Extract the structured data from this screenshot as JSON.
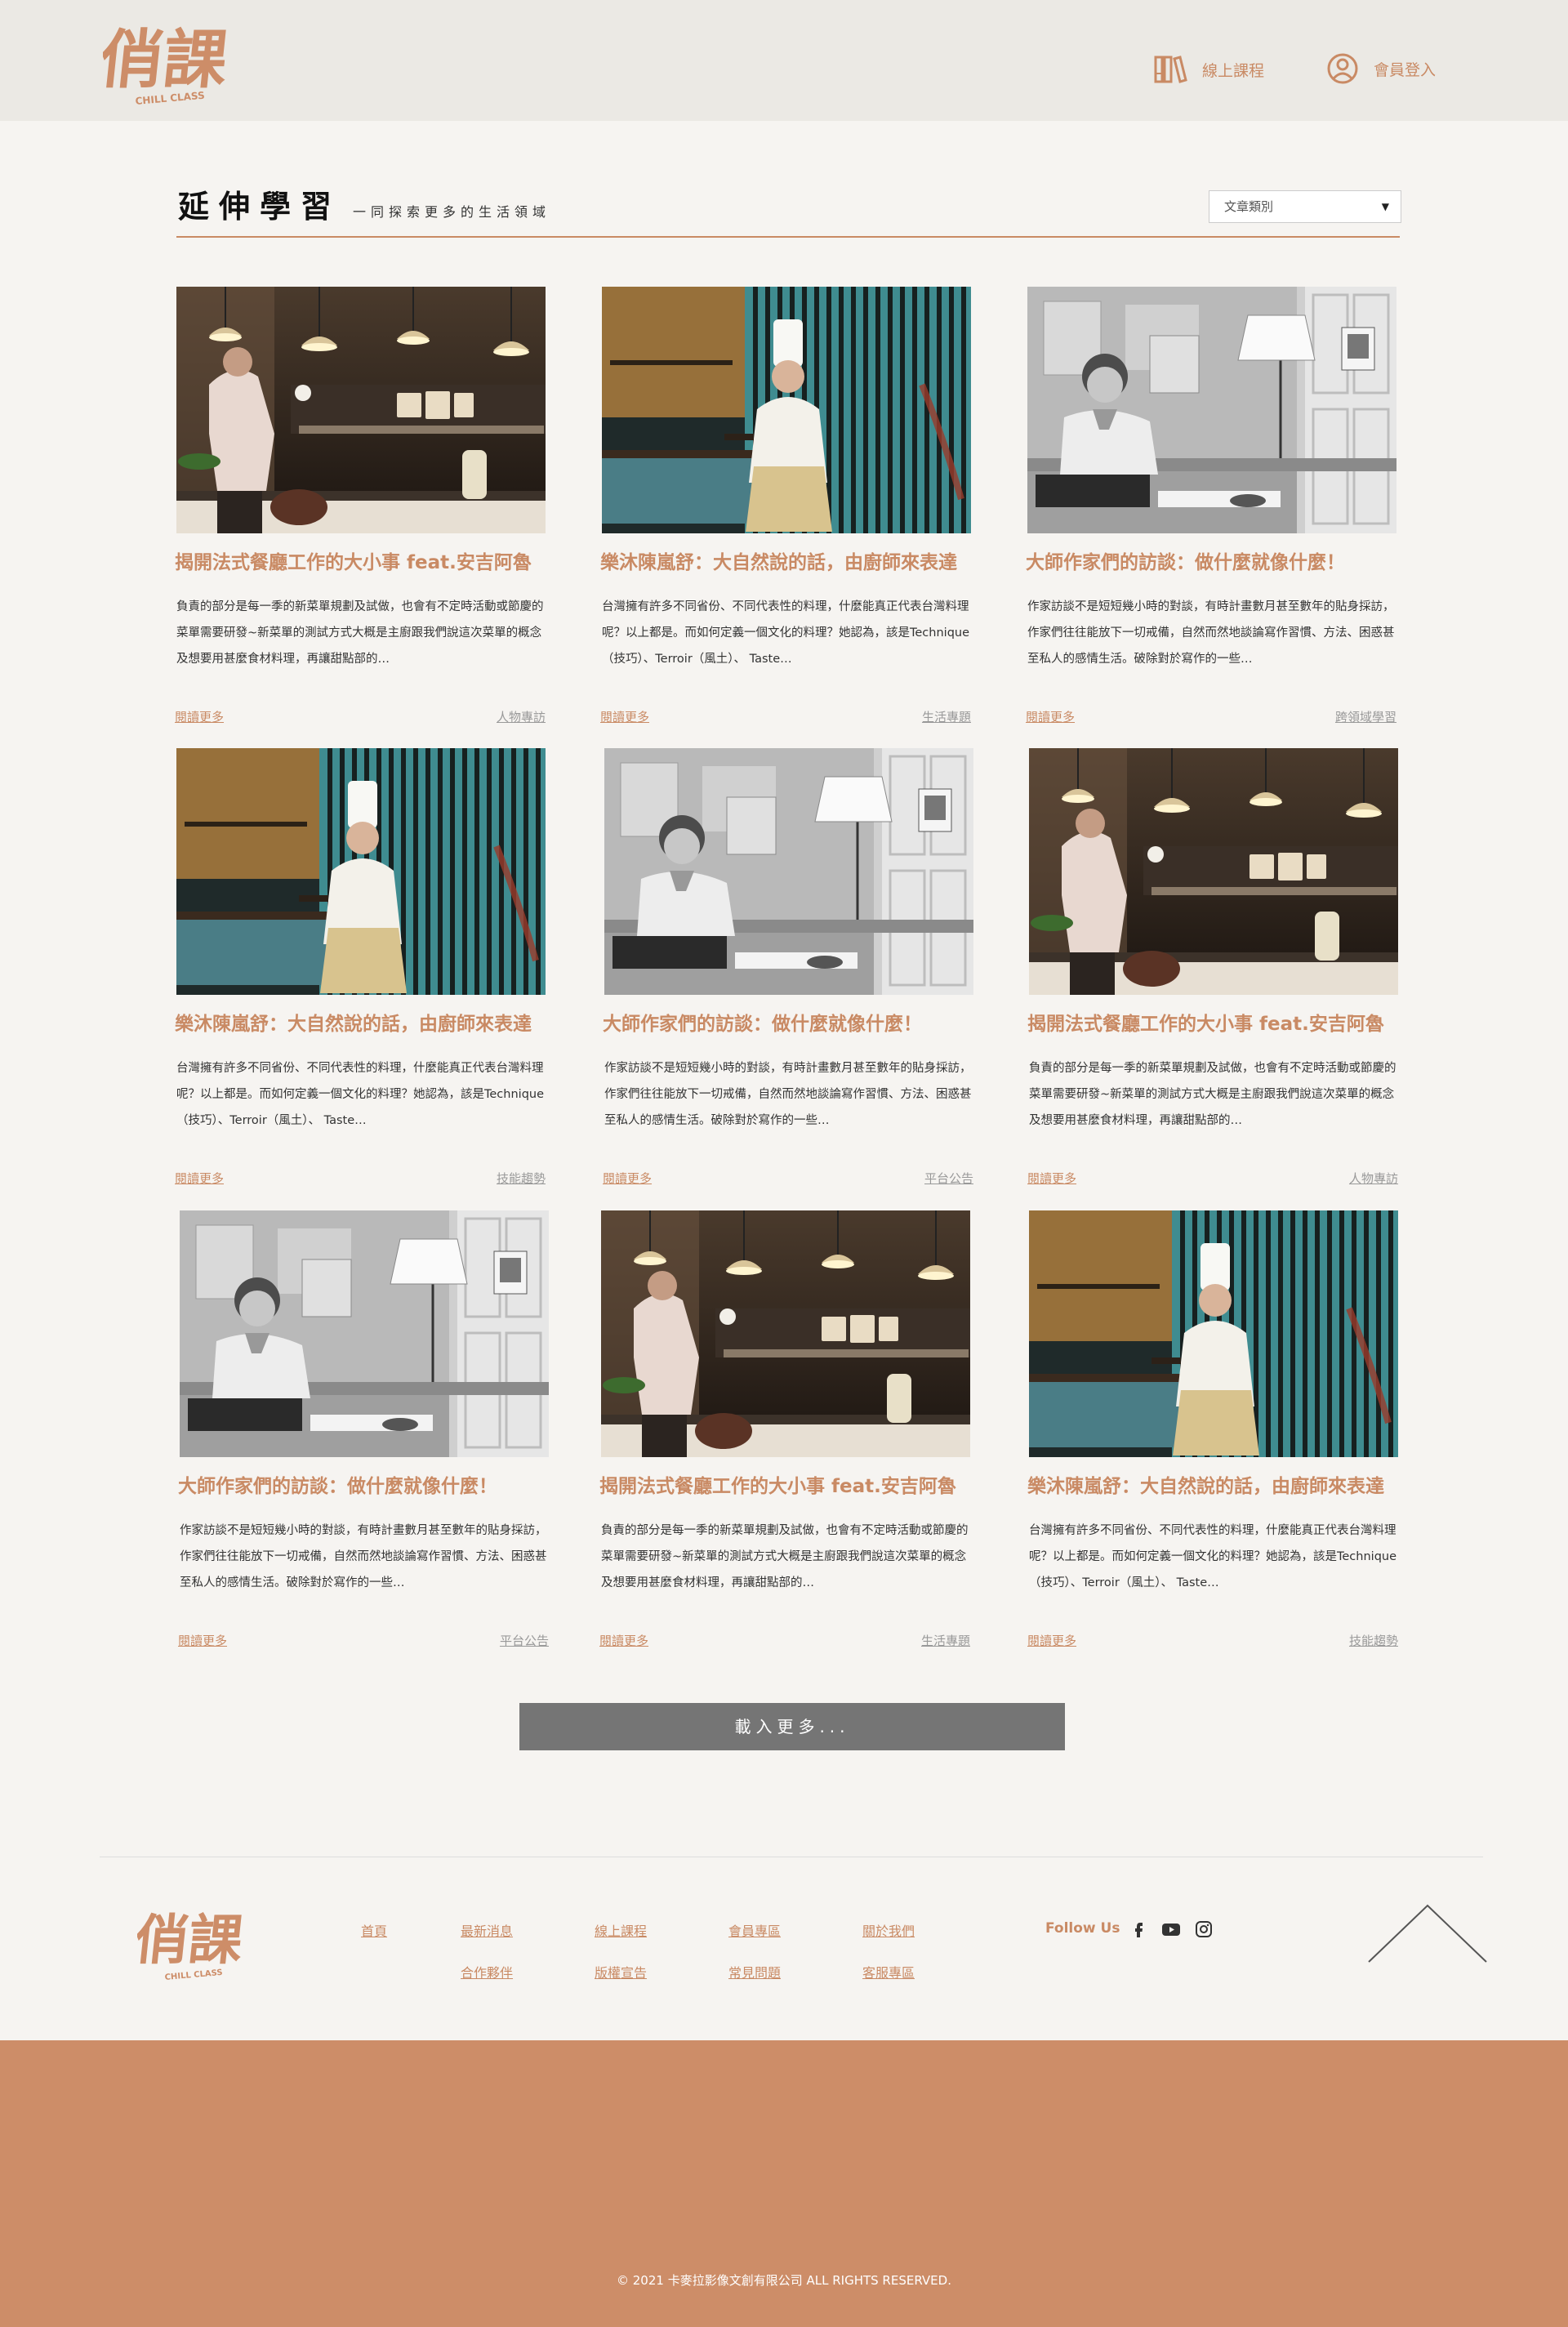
{
  "header": {
    "logo_text": "俏課",
    "logo_subtext": "CHILL CLASS",
    "nav": {
      "courses_label": "線上課程",
      "login_label": "會員登入"
    }
  },
  "section": {
    "title": "延伸學習",
    "subtitle": "一同探索更多的生活領域",
    "filter_placeholder": "文章類別"
  },
  "articles": [
    {
      "image": "chef-kitchen",
      "title": "揭開法式餐廳工作的大小事 feat.安吉阿魯",
      "excerpt": "負責的部分是每一季的新菜單規劃及試做，也會有不定時活動或節慶的菜單需要研發~新菜單的測試方式大概是主廚跟我們說這次菜單的概念及想要用甚麼食材料理，再讓甜點部的…",
      "more_label": "閱讀更多",
      "category": "人物專訪"
    },
    {
      "image": "chef-portrait",
      "title": "樂沐陳嵐舒：大自然說的話，由廚師來表達",
      "excerpt": "台灣擁有許多不同省份、不同代表性的料理，什麼能真正代表台灣料理呢？以上都是。而如何定義一個文化的料理？她認為，該是Technique（技巧）、Terroir（風土）、 Taste…",
      "more_label": "閱讀更多",
      "category": "生活專題"
    },
    {
      "image": "writer-desk",
      "title": "大師作家們的訪談：做什麼就像什麼！",
      "excerpt": "作家訪談不是短短幾小時的對談，有時計畫數月甚至數年的貼身採訪，作家們往往能放下一切戒備，自然而然地談論寫作習慣、方法、困惑甚至私人的感情生活。破除對於寫作的一些…",
      "more_label": "閱讀更多",
      "category": "跨領域學習"
    },
    {
      "image": "chef-portrait",
      "title": "樂沐陳嵐舒：大自然說的話，由廚師來表達",
      "excerpt": "台灣擁有許多不同省份、不同代表性的料理，什麼能真正代表台灣料理呢？以上都是。而如何定義一個文化的料理？她認為，該是Technique（技巧）、Terroir（風土）、 Taste…",
      "more_label": "閱讀更多",
      "category": "技能趨勢"
    },
    {
      "image": "writer-desk",
      "title": "大師作家們的訪談：做什麼就像什麼！",
      "excerpt": "作家訪談不是短短幾小時的對談，有時計畫數月甚至數年的貼身採訪，作家們往往能放下一切戒備，自然而然地談論寫作習慣、方法、困惑甚至私人的感情生活。破除對於寫作的一些…",
      "more_label": "閱讀更多",
      "category": "平台公告"
    },
    {
      "image": "chef-kitchen",
      "title": "揭開法式餐廳工作的大小事 feat.安吉阿魯",
      "excerpt": "負責的部分是每一季的新菜單規劃及試做，也會有不定時活動或節慶的菜單需要研發~新菜單的測試方式大概是主廚跟我們說這次菜單的概念及想要用甚麼食材料理，再讓甜點部的…",
      "more_label": "閱讀更多",
      "category": "人物專訪"
    },
    {
      "image": "writer-desk",
      "title": "大師作家們的訪談：做什麼就像什麼！",
      "excerpt": "作家訪談不是短短幾小時的對談，有時計畫數月甚至數年的貼身採訪，作家們往往能放下一切戒備，自然而然地談論寫作習慣、方法、困惑甚至私人的感情生活。破除對於寫作的一些…",
      "more_label": "閱讀更多",
      "category": "平台公告"
    },
    {
      "image": "chef-kitchen",
      "title": "揭開法式餐廳工作的大小事 feat.安吉阿魯",
      "excerpt": "負責的部分是每一季的新菜單規劃及試做，也會有不定時活動或節慶的菜單需要研發~新菜單的測試方式大概是主廚跟我們說這次菜單的概念及想要用甚麼食材料理，再讓甜點部的…",
      "more_label": "閱讀更多",
      "category": "生活專題"
    },
    {
      "image": "chef-portrait",
      "title": "樂沐陳嵐舒：大自然說的話，由廚師來表達",
      "excerpt": "台灣擁有許多不同省份、不同代表性的料理，什麼能真正代表台灣料理呢？以上都是。而如何定義一個文化的料理？她認為，該是Technique（技巧）、Terroir（風土）、 Taste…",
      "more_label": "閱讀更多",
      "category": "技能趨勢"
    }
  ],
  "load_more_label": "載入更多...",
  "footer": {
    "links_row1": [
      "首頁",
      "最新消息",
      "線上課程",
      "會員專區",
      "關於我們"
    ],
    "links_row2": [
      "合作夥伴",
      "版權宣告",
      "常見問題",
      "客服專區"
    ],
    "follow_label": "Follow Us",
    "social_icons": [
      "facebook-icon",
      "youtube-icon",
      "instagram-icon"
    ],
    "copyright": "© 2021 卡麥拉影像文創有限公司 ALL RIGHTS RESERVED."
  },
  "colors": {
    "accent": "#c98a64",
    "header_bg": "#ebe9e4",
    "page_bg": "#f6f4f1",
    "band_bg": "#cd8d68",
    "button_bg": "#757575"
  }
}
